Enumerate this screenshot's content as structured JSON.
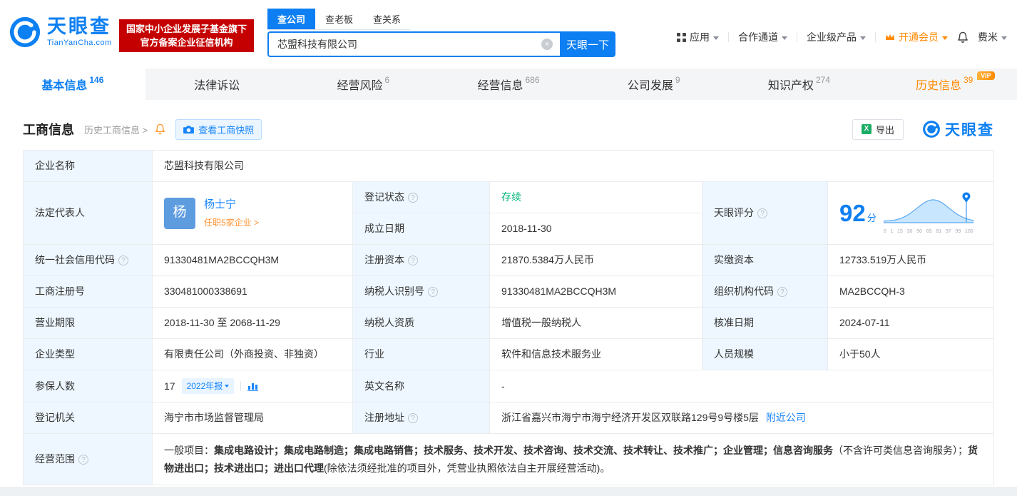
{
  "colors": {
    "primary": "#0d7ff2",
    "link": "#1684fc",
    "orange": "#ff8a00",
    "status_green": "#00b578",
    "badge_red": "#c40000",
    "label_cell_bg": "#eef7ff"
  },
  "header": {
    "logo_cn": "天眼查",
    "logo_en": "TianYanCha.com",
    "badge_line1": "国家中小企业发展子基金旗下",
    "badge_line2": "官方备案企业征信机构",
    "search_tabs": [
      {
        "label": "查公司",
        "active": true
      },
      {
        "label": "查老板",
        "active": false
      },
      {
        "label": "查关系",
        "active": false
      }
    ],
    "search_value": "芯盟科技有限公司",
    "search_button": "天眼一下",
    "nav": [
      {
        "label": "应用"
      },
      {
        "label": "合作通道"
      },
      {
        "label": "企业级产品"
      },
      {
        "label": "开通会员"
      },
      {
        "label": "费米"
      }
    ]
  },
  "tabs": [
    {
      "label": "基本信息",
      "count": "146",
      "active": true
    },
    {
      "label": "法律诉讼",
      "count": ""
    },
    {
      "label": "经营风险",
      "count": "6"
    },
    {
      "label": "经营信息",
      "count": "686"
    },
    {
      "label": "公司发展",
      "count": "9"
    },
    {
      "label": "知识产权",
      "count": "274"
    },
    {
      "label": "历史信息",
      "count": "39",
      "vip": "VIP"
    }
  ],
  "toolbar": {
    "title": "工商信息",
    "history_link": "历史工商信息 >",
    "snapshot_button": "查看工商快照",
    "export_button": "导出",
    "brand": "天眼查"
  },
  "info": {
    "company_name_label": "企业名称",
    "company_name": "芯盟科技有限公司",
    "legal_rep_label": "法定代表人",
    "legal_rep_avatar": "杨",
    "legal_rep_name": "杨士宁",
    "legal_rep_note": "任职5家企业 >",
    "reg_status_label": "登记状态",
    "reg_status": "存续",
    "establish_date_label": "成立日期",
    "establish_date": "2018-11-30",
    "score_label": "天眼评分",
    "score_value": "92",
    "score_unit": "分",
    "credit_code_label": "统一社会信用代码",
    "credit_code": "91330481MA2BCCQH3M",
    "reg_capital_label": "注册资本",
    "reg_capital": "21870.5384万人民币",
    "paid_capital_label": "实缴资本",
    "paid_capital": "12733.519万人民币",
    "reg_no_label": "工商注册号",
    "reg_no": "330481000338691",
    "taxpayer_id_label": "纳税人识别号",
    "taxpayer_id": "91330481MA2BCCQH3M",
    "org_code_label": "组织机构代码",
    "org_code": "MA2BCCQH-3",
    "business_term_label": "营业期限",
    "business_term": "2018-11-30 至 2068-11-29",
    "taxpayer_quality_label": "纳税人资质",
    "taxpayer_quality": "增值税一般纳税人",
    "approval_date_label": "核准日期",
    "approval_date": "2024-07-11",
    "company_type_label": "企业类型",
    "company_type": "有限责任公司（外商投资、非独资）",
    "industry_label": "行业",
    "industry": "软件和信息技术服务业",
    "staff_size_label": "人员规模",
    "staff_size": "小于50人",
    "insured_label": "参保人数",
    "insured_count": "17",
    "insured_badge": "2022年报",
    "english_name_label": "英文名称",
    "english_name": "-",
    "reg_authority_label": "登记机关",
    "reg_authority": "海宁市市场监督管理局",
    "address_label": "注册地址",
    "address": "浙江省嘉兴市海宁市海宁经济开发区双联路129号9号楼5层",
    "address_link": "附近公司",
    "scope_label": "经营范围",
    "scope_segments": [
      {
        "text": "一般项目：",
        "bold": false
      },
      {
        "text": "集成电路设计；集成电路制造；集成电路销售；技术服务、技术开发、技术咨询、技术交流、技术转让、技术推广；企业管理；信息咨询服务",
        "bold": true
      },
      {
        "text": "（不含许可类信息咨询服务）；",
        "bold": false
      },
      {
        "text": "货物进出口；技术进出口；进出口代理",
        "bold": true
      },
      {
        "text": "(除依法须经批准的项目外，凭营业执照依法自主开展经营活动)。",
        "bold": false
      }
    ]
  },
  "score_chart": {
    "type": "area",
    "score": 92,
    "xticks": [
      0,
      1,
      15,
      30,
      50,
      65,
      81,
      97,
      99,
      100
    ]
  }
}
